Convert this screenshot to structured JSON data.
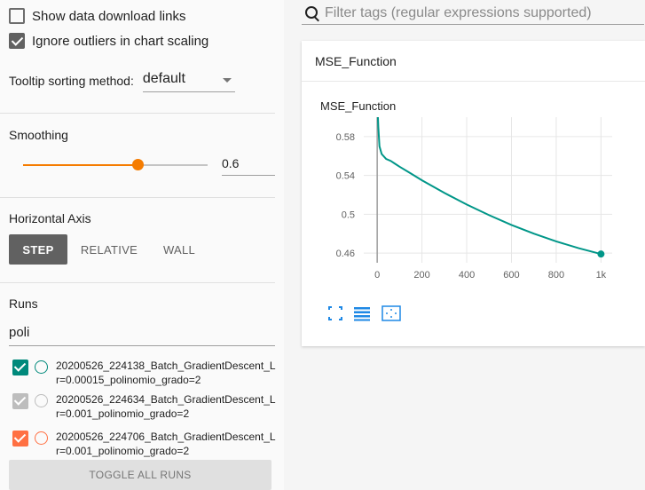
{
  "options": {
    "show_download_links": {
      "label": "Show data download links",
      "checked": false
    },
    "ignore_outliers": {
      "label": "Ignore outliers in chart scaling",
      "checked": true
    },
    "tooltip_sort": {
      "label": "Tooltip sorting method:",
      "value": "default"
    }
  },
  "smoothing": {
    "title": "Smoothing",
    "value": "0.6",
    "fraction": 0.6
  },
  "horizontal_axis": {
    "title": "Horizontal Axis",
    "buttons": [
      "STEP",
      "RELATIVE",
      "WALL"
    ],
    "active": "STEP"
  },
  "runs": {
    "title": "Runs",
    "filter_value": "poli",
    "items": [
      {
        "name": "20200526_224138_Batch_GradientDescent_Lr=0.00015_polinomio_grado=2",
        "checked": true,
        "color": "#00897b"
      },
      {
        "name": "20200526_224634_Batch_GradientDescent_Lr=0.001_polinomio_grado=2",
        "checked": true,
        "color": "#bdbdbd"
      },
      {
        "name": "20200526_224706_Batch_GradientDescent_Lr=0.001_polinomio_grado=2",
        "checked": true,
        "color": "#ff7043"
      }
    ],
    "toggle_label": "TOGGLE ALL RUNS"
  },
  "tag_filter": {
    "placeholder": "Filter tags (regular expressions supported)"
  },
  "card": {
    "header": "MSE_Function",
    "chart_title": "MSE_Function"
  },
  "chart_data": {
    "type": "line",
    "title": "MSE_Function",
    "xlabel": "",
    "ylabel": "",
    "x_ticks": [
      "0",
      "200",
      "400",
      "600",
      "800",
      "1k"
    ],
    "y_ticks": [
      "0.46",
      "0.5",
      "0.54",
      "0.58"
    ],
    "xlim": [
      -60,
      1050
    ],
    "ylim": [
      0.45,
      0.6
    ],
    "grid": true,
    "series": [
      {
        "color": "#009688",
        "x": [
          0,
          5,
          10,
          20,
          40,
          60,
          80,
          100,
          150,
          200,
          300,
          400,
          500,
          600,
          700,
          800,
          900,
          1000
        ],
        "y": [
          0.62,
          0.59,
          0.57,
          0.562,
          0.557,
          0.555,
          0.552,
          0.549,
          0.542,
          0.535,
          0.522,
          0.51,
          0.499,
          0.489,
          0.48,
          0.472,
          0.465,
          0.459
        ]
      }
    ]
  }
}
